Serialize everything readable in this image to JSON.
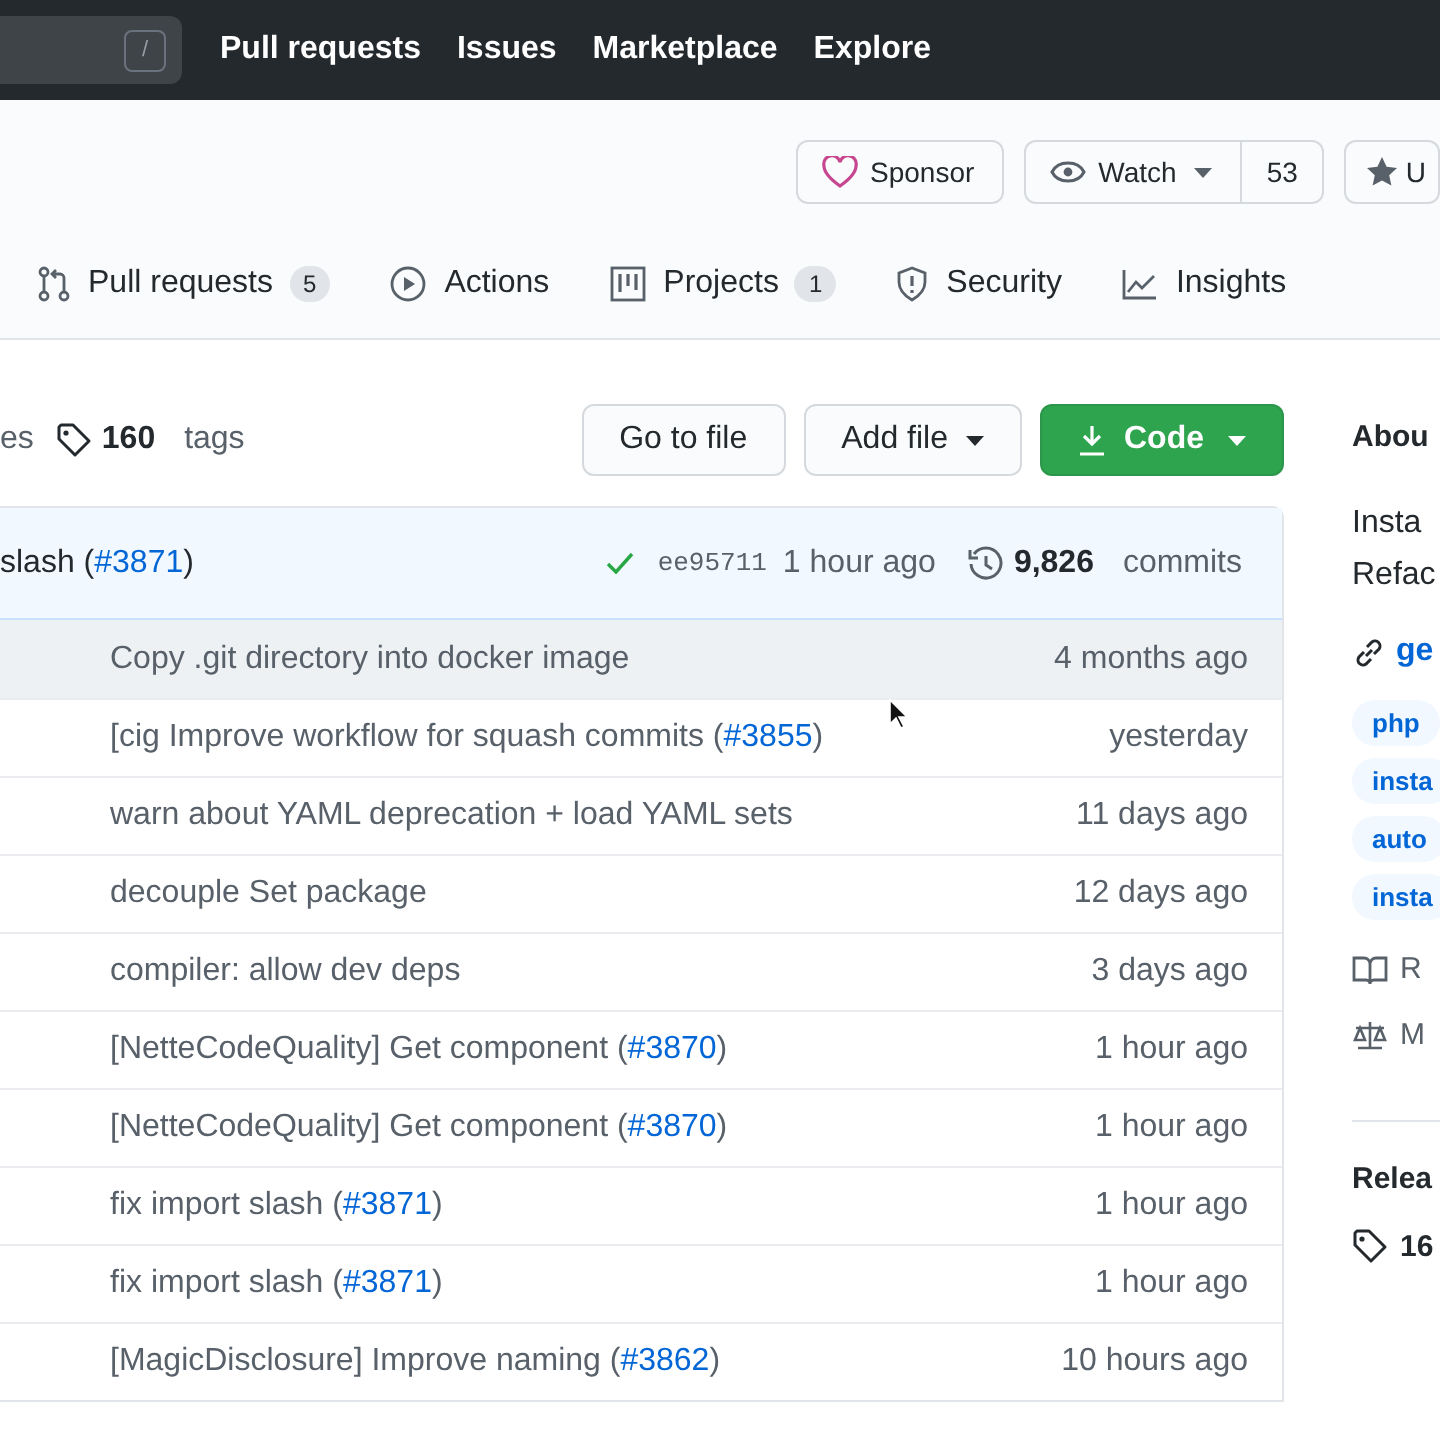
{
  "nav": {
    "search_key": "/",
    "links": [
      "Pull requests",
      "Issues",
      "Marketplace",
      "Explore"
    ]
  },
  "repo_actions": {
    "sponsor": "Sponsor",
    "watch": {
      "label": "Watch",
      "count": "53"
    },
    "star": "U"
  },
  "tabs": [
    {
      "label": "Pull requests",
      "count": "5",
      "selected": false
    },
    {
      "label": "Actions",
      "selected": false
    },
    {
      "label": "Projects",
      "count": "1",
      "selected": false
    },
    {
      "label": "Security",
      "selected": false
    },
    {
      "label": "Insights",
      "selected": false
    }
  ],
  "toolbar": {
    "branches_fragment": "es",
    "tags": {
      "count": "160",
      "label": "tags"
    },
    "buttons": [
      {
        "label": "Go to file",
        "kind": "plain"
      },
      {
        "label": "Add file",
        "kind": "dropdown"
      },
      {
        "label": "Code",
        "kind": "primary"
      }
    ]
  },
  "latest_commit": {
    "message": "slash (",
    "link": "#3871",
    "after": ")",
    "sha": "ee95711",
    "time": "1 hour ago",
    "commits": {
      "count": "9,826",
      "label": "commits"
    }
  },
  "files": [
    {
      "message": "Copy .git directory into docker image",
      "time": "4 months ago",
      "highlighted": true
    },
    {
      "message": "[cig Improve workflow for squash commits (",
      "link": "#3855",
      "after": ")",
      "time": "yesterday",
      "highlighted": false
    },
    {
      "message": "warn about YAML deprecation + load YAML sets",
      "time": "11 days ago",
      "highlighted": false
    },
    {
      "message": "decouple Set package",
      "time": "12 days ago",
      "highlighted": false
    },
    {
      "message": "compiler: allow dev deps",
      "time": "3 days ago",
      "highlighted": false
    },
    {
      "message": "[NetteCodeQuality] Get component (",
      "link": "#3870",
      "after": ")",
      "time": "1 hour ago",
      "highlighted": false
    },
    {
      "message": "[NetteCodeQuality] Get component (",
      "link": "#3870",
      "after": ")",
      "time": "1 hour ago",
      "highlighted": false
    },
    {
      "message": "fix import slash (",
      "link": "#3871",
      "after": ")",
      "time": "1 hour ago",
      "highlighted": false
    },
    {
      "message": "fix import slash (",
      "link": "#3871",
      "after": ")",
      "time": "1 hour ago",
      "highlighted": false
    },
    {
      "message": "[MagicDisclosure] Improve naming (",
      "link": "#3862",
      "after": ")",
      "time": "10 hours ago",
      "highlighted": false
    }
  ],
  "sidebar": {
    "about_heading": "Abou",
    "description": [
      "Insta",
      "Refac"
    ],
    "link": "ge",
    "topics": [
      "php",
      "insta",
      "auto",
      "insta"
    ],
    "items": [
      {
        "kind": "readme",
        "label": "R"
      },
      {
        "kind": "license",
        "label": "M"
      }
    ],
    "releases_heading": "Relea",
    "releases_count": "16"
  }
}
